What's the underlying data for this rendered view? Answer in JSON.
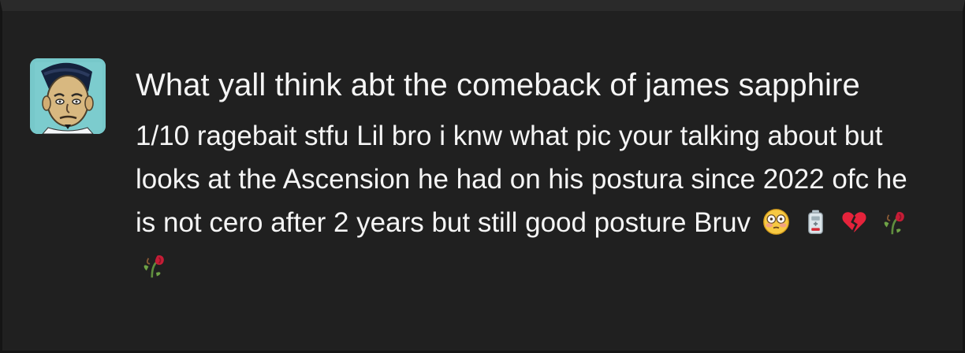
{
  "post": {
    "avatar_icon": "cartoon-man-avatar",
    "title": "What yall think abt the comeback of james sapphire",
    "body_text": "1/10 ragebait stfu Lil bro i knw what pic your talking about but looks at the Ascension he had on his postura since 2022 ofc he is not cero after 2 years but still good posture Bruv",
    "emojis": [
      "😳",
      "🔋",
      "💔",
      "🥀",
      "🥀"
    ]
  }
}
